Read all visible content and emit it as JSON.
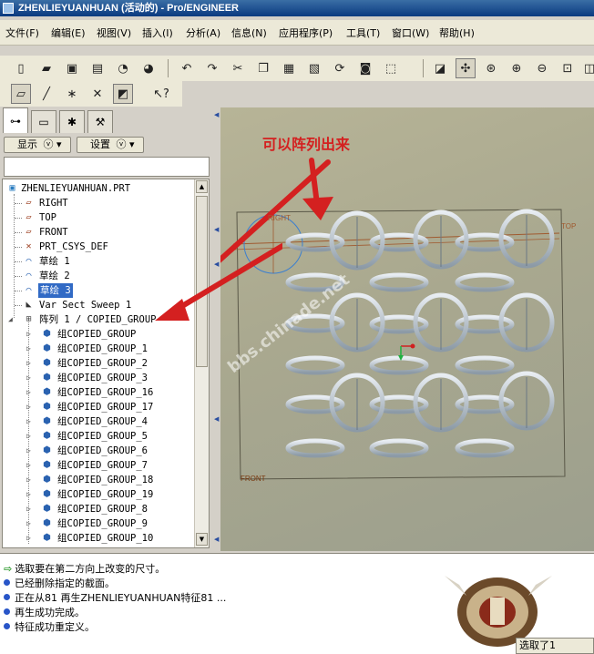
{
  "window": {
    "title": "ZHENLIEYUANHUAN (活动的) - Pro/ENGINEER"
  },
  "menu": [
    "文件(F)",
    "编辑(E)",
    "视图(V)",
    "插入(I)",
    "分析(A)",
    "信息(N)",
    "应用程序(P)",
    "工具(T)",
    "窗口(W)",
    "帮助(H)"
  ],
  "panel": {
    "show_button": "显示",
    "settings_button": "设置",
    "tree": [
      {
        "label": "ZHENLIEYUANHUAN.PRT",
        "icon": "part-icon"
      },
      {
        "label": "RIGHT",
        "icon": "datum-plane-icon"
      },
      {
        "label": "TOP",
        "icon": "datum-plane-icon"
      },
      {
        "label": "FRONT",
        "icon": "datum-plane-icon"
      },
      {
        "label": "PRT_CSYS_DEF",
        "icon": "csys-icon"
      },
      {
        "label": "草绘 1",
        "icon": "sketch-icon"
      },
      {
        "label": "草绘 2",
        "icon": "sketch-icon"
      },
      {
        "label": "草绘 3",
        "icon": "sketch-icon",
        "selected": true
      },
      {
        "label": "Var Sect Sweep 1",
        "icon": "sweep-icon"
      },
      {
        "label": "阵列 1 / COPIED_GROUP",
        "icon": "pattern-icon"
      },
      {
        "label": "组COPIED_GROUP",
        "icon": "group-icon"
      },
      {
        "label": "组COPIED_GROUP_1",
        "icon": "group-icon"
      },
      {
        "label": "组COPIED_GROUP_2",
        "icon": "group-icon"
      },
      {
        "label": "组COPIED_GROUP_3",
        "icon": "group-icon"
      },
      {
        "label": "组COPIED_GROUP_16",
        "icon": "group-icon"
      },
      {
        "label": "组COPIED_GROUP_17",
        "icon": "group-icon"
      },
      {
        "label": "组COPIED_GROUP_4",
        "icon": "group-icon"
      },
      {
        "label": "组COPIED_GROUP_5",
        "icon": "group-icon"
      },
      {
        "label": "组COPIED_GROUP_6",
        "icon": "group-icon"
      },
      {
        "label": "组COPIED_GROUP_7",
        "icon": "group-icon"
      },
      {
        "label": "组COPIED_GROUP_18",
        "icon": "group-icon"
      },
      {
        "label": "组COPIED_GROUP_19",
        "icon": "group-icon"
      },
      {
        "label": "组COPIED_GROUP_8",
        "icon": "group-icon"
      },
      {
        "label": "组COPIED_GROUP_9",
        "icon": "group-icon"
      },
      {
        "label": "组COPIED_GROUP_10",
        "icon": "group-icon"
      }
    ]
  },
  "viewport": {
    "annotation": "可以阵列出来",
    "datum_right": "RIGHT",
    "datum_top": "TOP",
    "datum_front": "FRONT",
    "watermark": "bbs.chinade.net"
  },
  "messages": [
    {
      "text": "选取要在第二方向上改变的尺寸。",
      "kind": "prompt"
    },
    {
      "text": "已经删除指定的截面。",
      "kind": "info"
    },
    {
      "text": "正在从81 再生ZHENLIEYUANHUAN特征81 ...",
      "kind": "info"
    },
    {
      "text": "再生成功完成。",
      "kind": "info"
    },
    {
      "text": "特征成功重定义。",
      "kind": "info"
    }
  ],
  "status": {
    "selection": "选取了1"
  },
  "colors": {
    "selection": "#316ac5",
    "annotation_arrow": "#d42020",
    "viewport_bg": "#a9a88f"
  }
}
